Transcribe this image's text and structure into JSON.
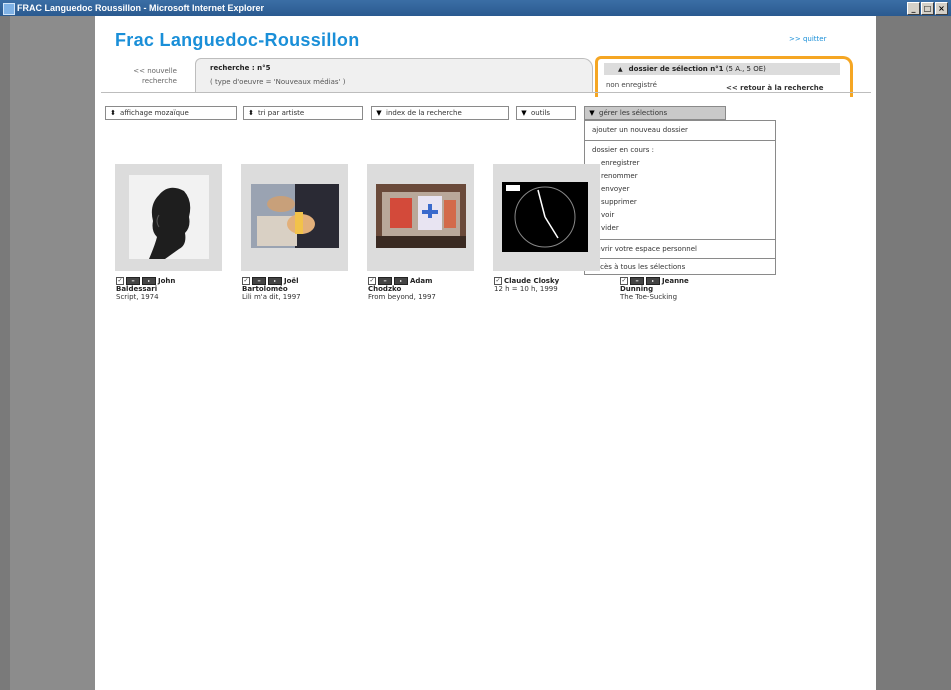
{
  "window": {
    "title": "FRAC Languedoc Roussillon - Microsoft Internet Explorer",
    "buttons": [
      "_",
      "□",
      "×"
    ]
  },
  "header": {
    "brand": "Frac Languedoc-Roussillon",
    "quit": ">> quitter",
    "new_search_line1": "<< nouvelle",
    "new_search_line2": "recherche"
  },
  "search_tab": {
    "title": "recherche : n°5",
    "criteria": "( type d'oeuvre = 'Nouveaux médias' )"
  },
  "selection_tab": {
    "title": "dossier de sélection n°1",
    "count": "(5 A., 5 OE)",
    "status": "non enregistré",
    "back": "<< retour à la recherche"
  },
  "toolbar": {
    "display": "affichage mozaïque",
    "sort": "tri par artiste",
    "index": "index de la recherche",
    "tools": "outils",
    "manage": "gérer les sélections"
  },
  "menu": {
    "add_folder": "ajouter un nouveau dossier",
    "current_folder": "dossier en cours :",
    "actions": [
      "enregistrer",
      "renommer",
      "envoyer",
      "supprimer",
      "voir",
      "vider"
    ],
    "open_space": "ouvrir votre espace personnel",
    "all_selections": "accès à tous les sélections"
  },
  "artworks": [
    {
      "name_line1": "John",
      "name_line2": "Baldessari",
      "work": "Script, 1974",
      "thumb_icon": "portrait-profile"
    },
    {
      "name_line1": "Joël",
      "name_line2": "Bartoloméo",
      "work": "Lili m'a dit, 1997",
      "thumb_icon": "hand-still"
    },
    {
      "name_line1": "Adam",
      "name_line2": "Chodzko",
      "work": "From beyond, 1997",
      "thumb_icon": "stage-scene"
    },
    {
      "name_line1": "Claude Closky",
      "name_line2": "",
      "work": "12 h = 10 h, 1999",
      "thumb_icon": "clock"
    },
    {
      "name_line1": "Jeanne",
      "name_line2": "Dunning",
      "work": "The Toe-Sucking",
      "thumb_icon": "video-still"
    }
  ]
}
